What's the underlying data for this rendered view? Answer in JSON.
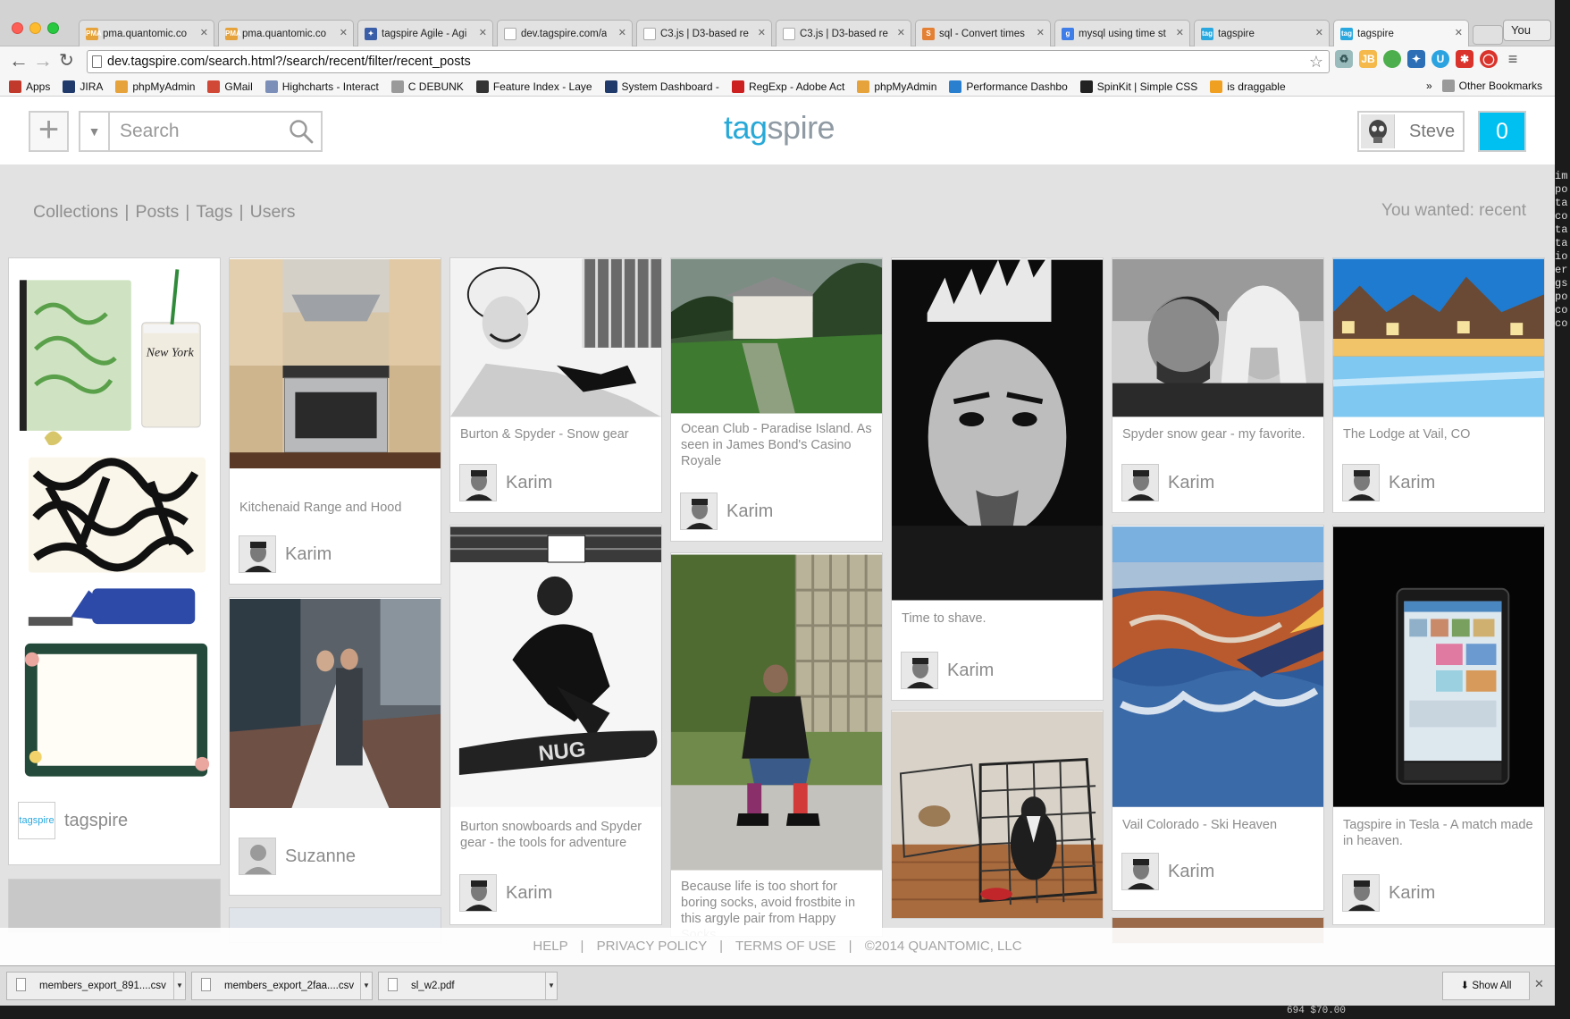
{
  "browser": {
    "tabs": [
      {
        "label": "pma.quantomic.co",
        "favicon": "PMA",
        "color": "#e6a33b"
      },
      {
        "label": "pma.quantomic.co",
        "favicon": "PMA",
        "color": "#e6a33b"
      },
      {
        "label": "tagspire Agile - Agi",
        "favicon": "✦",
        "color": "#3b5ea8"
      },
      {
        "label": "dev.tagspire.com/a",
        "favicon": "",
        "color": "#ffffff"
      },
      {
        "label": "C3.js | D3-based re",
        "favicon": "",
        "color": "#ffffff"
      },
      {
        "label": "C3.js | D3-based re",
        "favicon": "",
        "color": "#ffffff"
      },
      {
        "label": "sql - Convert times",
        "favicon": "S",
        "color": "#e48034"
      },
      {
        "label": "mysql using time st",
        "favicon": "g",
        "color": "#3f7ee8"
      },
      {
        "label": "tagspire",
        "favicon": "tag",
        "color": "#29a8e0"
      },
      {
        "label": "tagspire",
        "favicon": "tag",
        "color": "#29a8e0",
        "active": true
      }
    ],
    "profile_label": "You",
    "url": "dev.tagspire.com/search.html?/search/recent/filter/recent_posts",
    "bookmarks": [
      {
        "label": "Apps",
        "color": "#c0392b"
      },
      {
        "label": "JIRA",
        "color": "#1f3a6b"
      },
      {
        "label": "phpMyAdmin",
        "color": "#e6a33b"
      },
      {
        "label": "GMail",
        "color": "#d14836"
      },
      {
        "label": "Highcharts - Interact",
        "color": "#7b8fb8"
      },
      {
        "label": "C DEBUNK",
        "color": "#9a9a9a"
      },
      {
        "label": "Feature Index - Laye",
        "color": "#333333"
      },
      {
        "label": "System Dashboard -",
        "color": "#1f3a6b"
      },
      {
        "label": "RegExp - Adobe Act",
        "color": "#cc1f1f"
      },
      {
        "label": "phpMyAdmin",
        "color": "#e6a33b"
      },
      {
        "label": "Performance Dashbo",
        "color": "#2a7fcf"
      },
      {
        "label": "SpinKit | Simple CSS",
        "color": "#222222"
      },
      {
        "label": "is draggable",
        "color": "#f0a020"
      }
    ],
    "bookmarks_more": "»",
    "other_bookmarks": "Other Bookmarks"
  },
  "header": {
    "search_placeholder": "Search",
    "logo_a": "tag",
    "logo_b": "spire",
    "user_name": "Steve",
    "count": "0"
  },
  "filters": {
    "items": [
      "Collections",
      "Posts",
      "Tags",
      "Users"
    ],
    "sep": "|",
    "wanted": "You wanted: recent"
  },
  "cards": [
    {
      "caption": "",
      "author": "tagspire"
    },
    {
      "caption": "Kitchenaid Range and Hood",
      "author": "Karim"
    },
    {
      "caption": "",
      "author": "Suzanne"
    },
    {
      "caption": "Burton & Spyder - Snow gear",
      "author": "Karim"
    },
    {
      "caption": "Burton snowboards and Spyder gear - the tools for adventure",
      "author": "Karim"
    },
    {
      "caption": "Ocean Club - Paradise Island. As seen in James Bond's Casino Royale",
      "author": "Karim"
    },
    {
      "caption": "Because life is too short for boring socks, avoid frostbite in this argyle pair from Happy Socks",
      "author": ""
    },
    {
      "caption": "Time to shave.",
      "author": "Karim"
    },
    {
      "caption": "",
      "author": ""
    },
    {
      "caption": "Spyder snow gear - my favorite.",
      "author": "Karim"
    },
    {
      "caption": "Vail Colorado - Ski Heaven",
      "author": "Karim"
    },
    {
      "caption": "The Lodge at Vail, CO",
      "author": "Karim"
    },
    {
      "caption": "Tagspire in Tesla - A match made in heaven.",
      "author": "Karim"
    }
  ],
  "footer": {
    "help": "HELP",
    "privacy": "PRIVACY POLICY",
    "terms": "TERMS OF USE",
    "copyright": "©2014 QUANTOMIC, LLC",
    "sep": "|"
  },
  "downloads": {
    "items": [
      "members_export_891....csv",
      "members_export_2faa....csv",
      "sl_w2.pdf"
    ],
    "show_all": "Show All"
  },
  "background_terminal": {
    "lines": [
      "im",
      "po",
      "ta",
      "co",
      "ta",
      "ta",
      "io",
      "er",
      "gs",
      "po",
      "co",
      "co"
    ],
    "bottom_text": "694    $70.00"
  }
}
